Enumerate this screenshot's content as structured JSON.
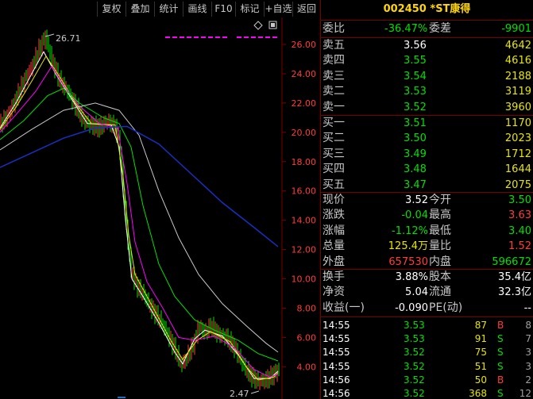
{
  "toolbar": {
    "buttons": [
      "复权",
      "叠加",
      "统计",
      "画线",
      "F10",
      "标记",
      "+自选",
      "返回"
    ]
  },
  "chart": {
    "high_label": "26.71",
    "low_label": "2.47",
    "y_ticks": [
      "26.00",
      "24.00",
      "22.00",
      "20.00",
      "18.00",
      "16.00",
      "14.00",
      "12.00",
      "10.00",
      "8.00",
      "6.00",
      "4.00"
    ]
  },
  "quote": {
    "code": "002450",
    "name": "*ST康得",
    "weibi_label": "委比",
    "weibi_value": "-36.47%",
    "weicha_label": "委差",
    "weicha_value": "-9901",
    "asks": [
      {
        "label": "卖五",
        "price": "3.56",
        "vol": "4642"
      },
      {
        "label": "卖四",
        "price": "3.55",
        "vol": "4616"
      },
      {
        "label": "卖三",
        "price": "3.54",
        "vol": "2188"
      },
      {
        "label": "卖二",
        "price": "3.53",
        "vol": "3119"
      },
      {
        "label": "卖一",
        "price": "3.52",
        "vol": "3960"
      }
    ],
    "bids": [
      {
        "label": "买一",
        "price": "3.51",
        "vol": "1170"
      },
      {
        "label": "买二",
        "price": "3.50",
        "vol": "2023"
      },
      {
        "label": "买三",
        "price": "3.49",
        "vol": "1712"
      },
      {
        "label": "买四",
        "price": "3.48",
        "vol": "1644"
      },
      {
        "label": "买五",
        "price": "3.47",
        "vol": "2075"
      }
    ],
    "stats": [
      {
        "l1": "现价",
        "v1": "3.52",
        "l2": "今开",
        "v2": "3.50"
      },
      {
        "l1": "涨跌",
        "v1": "-0.04",
        "l2": "最高",
        "v2": "3.63"
      },
      {
        "l1": "涨幅",
        "v1": "-1.12%",
        "l2": "最低",
        "v2": "3.40"
      },
      {
        "l1": "总量",
        "v1": "125.4万",
        "l2": "量比",
        "v2": "1.52"
      },
      {
        "l1": "外盘",
        "v1": "657530",
        "l2": "内盘",
        "v2": "596672"
      }
    ],
    "fund": [
      {
        "l1": "换手",
        "v1": "3.88%",
        "l2": "股本",
        "v2": "35.4亿"
      },
      {
        "l1": "净资",
        "v1": "5.04",
        "l2": "流通",
        "v2": "32.3亿"
      },
      {
        "l1": "收益(一)",
        "v1": "-0.090",
        "l2": "PE(动)",
        "v2": "--"
      }
    ],
    "ticks": [
      {
        "time": "14:55",
        "price": "3.53",
        "vol": "87",
        "side": "B",
        "n": "8"
      },
      {
        "time": "14:55",
        "price": "3.53",
        "vol": "91",
        "side": "S",
        "n": "7"
      },
      {
        "time": "14:55",
        "price": "3.52",
        "vol": "75",
        "side": "S",
        "n": "3"
      },
      {
        "time": "14:55",
        "price": "3.52",
        "vol": "51",
        "side": "S",
        "n": "3"
      },
      {
        "time": "14:56",
        "price": "3.52",
        "vol": "50",
        "side": "B",
        "n": "2"
      },
      {
        "time": "14:56",
        "price": "3.52",
        "vol": "368",
        "side": "S",
        "n": "12"
      }
    ]
  },
  "colors": {
    "up": "#ff3c3c",
    "down": "#00e000",
    "flat": "#e6e600",
    "ma5": "#ffffff",
    "ma10": "#e6e600",
    "ma20": "#ff00ff",
    "ma30": "#00e000",
    "ma60": "#c8c8c8",
    "ma120": "#1a2fc0"
  }
}
